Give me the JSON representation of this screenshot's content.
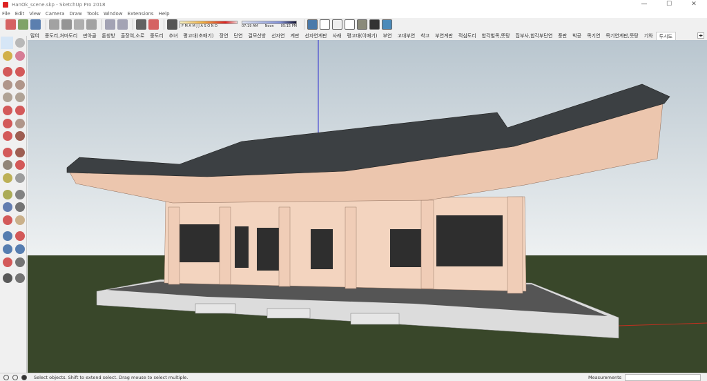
{
  "window": {
    "title": "HanOk_scene.skp - SketchUp Pro 2018",
    "controls": [
      "—",
      "☐",
      "✕"
    ]
  },
  "menu": [
    "File",
    "Edit",
    "View",
    "Camera",
    "Draw",
    "Tools",
    "Window",
    "Extensions",
    "Help"
  ],
  "toolbar": {
    "icons": [
      "new-icon",
      "open-icon",
      "save-icon",
      "cut-icon",
      "copy-icon",
      "paste-icon",
      "erase-icon",
      "undo-icon",
      "redo-icon",
      "print-icon",
      "model-info-icon",
      "shadows-icon"
    ],
    "shadow_months": "J F M A M J J A S O N D",
    "shadow_times": {
      "start": "07:19 AM",
      "mid": "Noon",
      "end": "05:15 PM"
    },
    "style_icons": [
      "xray-icon",
      "back-edges-icon",
      "wireframe-icon",
      "hidden-line-icon",
      "shaded-icon",
      "shaded-textures-icon",
      "monochrome-icon"
    ]
  },
  "scenes": {
    "tabs": [
      "많여",
      "종도리,처마도리",
      "판아골",
      "툰창방",
      "출장여,소로",
      "중도리",
      "추녀",
      "평고대(초매기)",
      "장연",
      "단연",
      "걸모산방",
      "선자연",
      "계판",
      "선자연계판",
      "사래",
      "평고대(이매기)",
      "부연",
      "고대부연",
      "착고",
      "부연계판",
      "적심도리",
      "합각벌목,뜻탕",
      "집부사,합각부단연",
      "풍판",
      "박공",
      "목기연",
      "목기연계판,뜻탕",
      "기와",
      "투시도"
    ],
    "active": "투시도",
    "scroll": "◂▸"
  },
  "lefttools": [
    "select-icon",
    "component-icon",
    "paint-bucket-icon",
    "eraser-icon",
    "pencil-icon",
    "freehand-icon",
    "rectangle-icon",
    "rotated-rectangle-icon",
    "circle-icon",
    "polygon-icon",
    "arc-icon",
    "pie-icon",
    "two-point-arc-icon",
    "three-point-arc-icon",
    "move-icon",
    "push-pull-icon",
    "rotate-icon",
    "follow-me-icon",
    "scale-icon",
    "offset-icon",
    "tape-measure-icon",
    "dimension-icon",
    "protractor-icon",
    "text-icon",
    "axes-icon",
    "3d-text-icon",
    "orbit-icon",
    "pan-icon",
    "zoom-icon",
    "zoom-window-icon",
    "zoom-extents-icon",
    "previous-view-icon",
    "position-camera-icon",
    "look-around-icon",
    "walk-icon",
    "section-plane-icon"
  ],
  "colors": {
    "sky_top": "#b9c6cf",
    "sky_bottom": "#eef1f2",
    "ground": "#39472a",
    "roof": "#3c4043",
    "timber": "#ecc6ae",
    "wall": "#f3d4bf",
    "stone": "#dcdcdc",
    "axis_blue": "#2a2ad0",
    "axis_red": "#c03020"
  },
  "status": {
    "message": "Select objects. Shift to extend select. Drag mouse to select multiple.",
    "measurements_label": "Measurements",
    "measurements_value": ""
  }
}
